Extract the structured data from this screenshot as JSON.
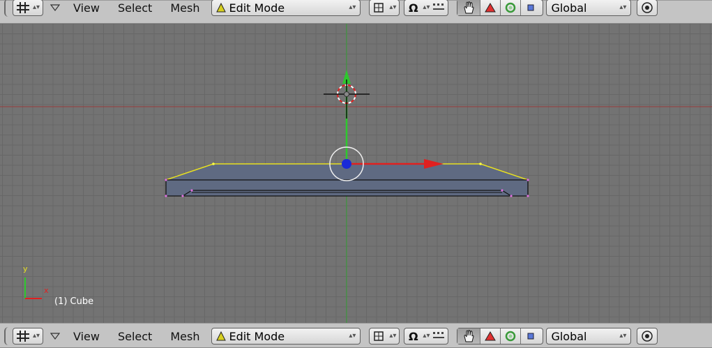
{
  "header": {
    "menus": [
      "View",
      "Select",
      "Mesh"
    ],
    "mode_label": "Edit Mode",
    "transform_orientation": "Global"
  },
  "viewport": {
    "object_label": "(1) Cube",
    "axis_y": "y",
    "axis_x": "x"
  },
  "icons": [
    "grid-icon",
    "collapse-triangle-icon",
    "edit-mode-icon",
    "draw-type-icon",
    "pivot-icon",
    "snap-icon",
    "manipulator-hand-icon",
    "translate-icon",
    "rotate-icon",
    "scale-icon",
    "proportional-edit-icon"
  ],
  "colors": {
    "viewport_bg": "#737373",
    "x_axis": "#9a3b3b",
    "y_axis": "#35a035",
    "selected_edge": "#ffff33",
    "vertex": "#e070e0",
    "mesh_face": "#5f6a82"
  }
}
